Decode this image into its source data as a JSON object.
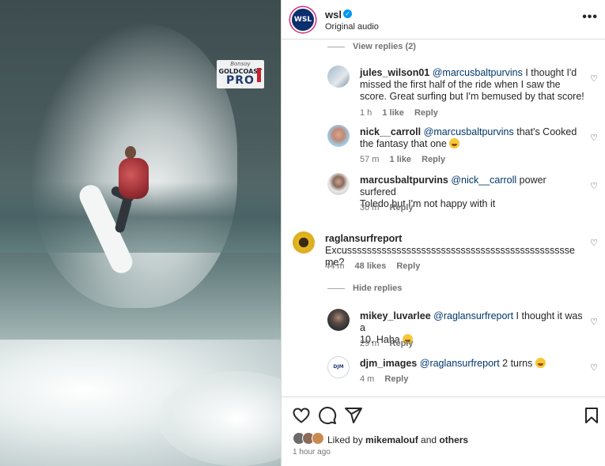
{
  "media": {
    "brand_top": "Bonsoy",
    "brand_mid": "GOLDCOAST",
    "brand_big": "PRO"
  },
  "header": {
    "avatar_text": "WSL",
    "username": "wsl",
    "subtitle": "Original audio",
    "more_icon": "•••"
  },
  "view_replies": "View replies (2)",
  "hide_replies": "Hide replies",
  "comments": [
    {
      "username": "jules_wilson01",
      "mention": "@marcusbaltpurvins",
      "text_line1": " I thought I'd",
      "text_line2": "missed the first half of the ride when I saw the",
      "text_line3": "score. Great surfing but I'm bemused by that score!",
      "time": "1 h",
      "likes": "1 like",
      "reply": "Reply"
    },
    {
      "username": "nick__carroll",
      "mention": "@marcusbaltpurvins",
      "text_line1": " that's Cooked",
      "text_line2": "the fantasy that one",
      "time": "57 m",
      "likes": "1 like",
      "reply": "Reply"
    },
    {
      "username": "marcusbaltpurvins",
      "mention": "@nick__carroll",
      "text_line1": " power surfered",
      "text_line2": "Toledo but I'm not happy with it",
      "time": "30 m",
      "reply": "Reply"
    },
    {
      "username": "raglansurfreport",
      "text_line2": "Excussssssssssssssssssssssssssssssssssssssssssssse me?",
      "time": "44 m",
      "likes": "48 likes",
      "reply": "Reply"
    },
    {
      "username": "mikey_luvarlee",
      "mention": "@raglansurfreport",
      "text_line1": " I thought it was a",
      "text_line2": "10. Haha",
      "time": "29 m",
      "reply": "Reply"
    },
    {
      "username": "djm_images",
      "mention": "@raglansurfreport",
      "text_line1": " 2 turns",
      "avatar_text": "DJM",
      "time": "4 m",
      "reply": "Reply"
    }
  ],
  "footer": {
    "liked_prefix": "Liked by ",
    "liked_user": "mikemalouf",
    "liked_and": " and ",
    "liked_others": "others",
    "time": "1 hour ago"
  },
  "colors": {
    "mention": "#00376b",
    "muted": "#737373",
    "verified": "#0095f6"
  }
}
